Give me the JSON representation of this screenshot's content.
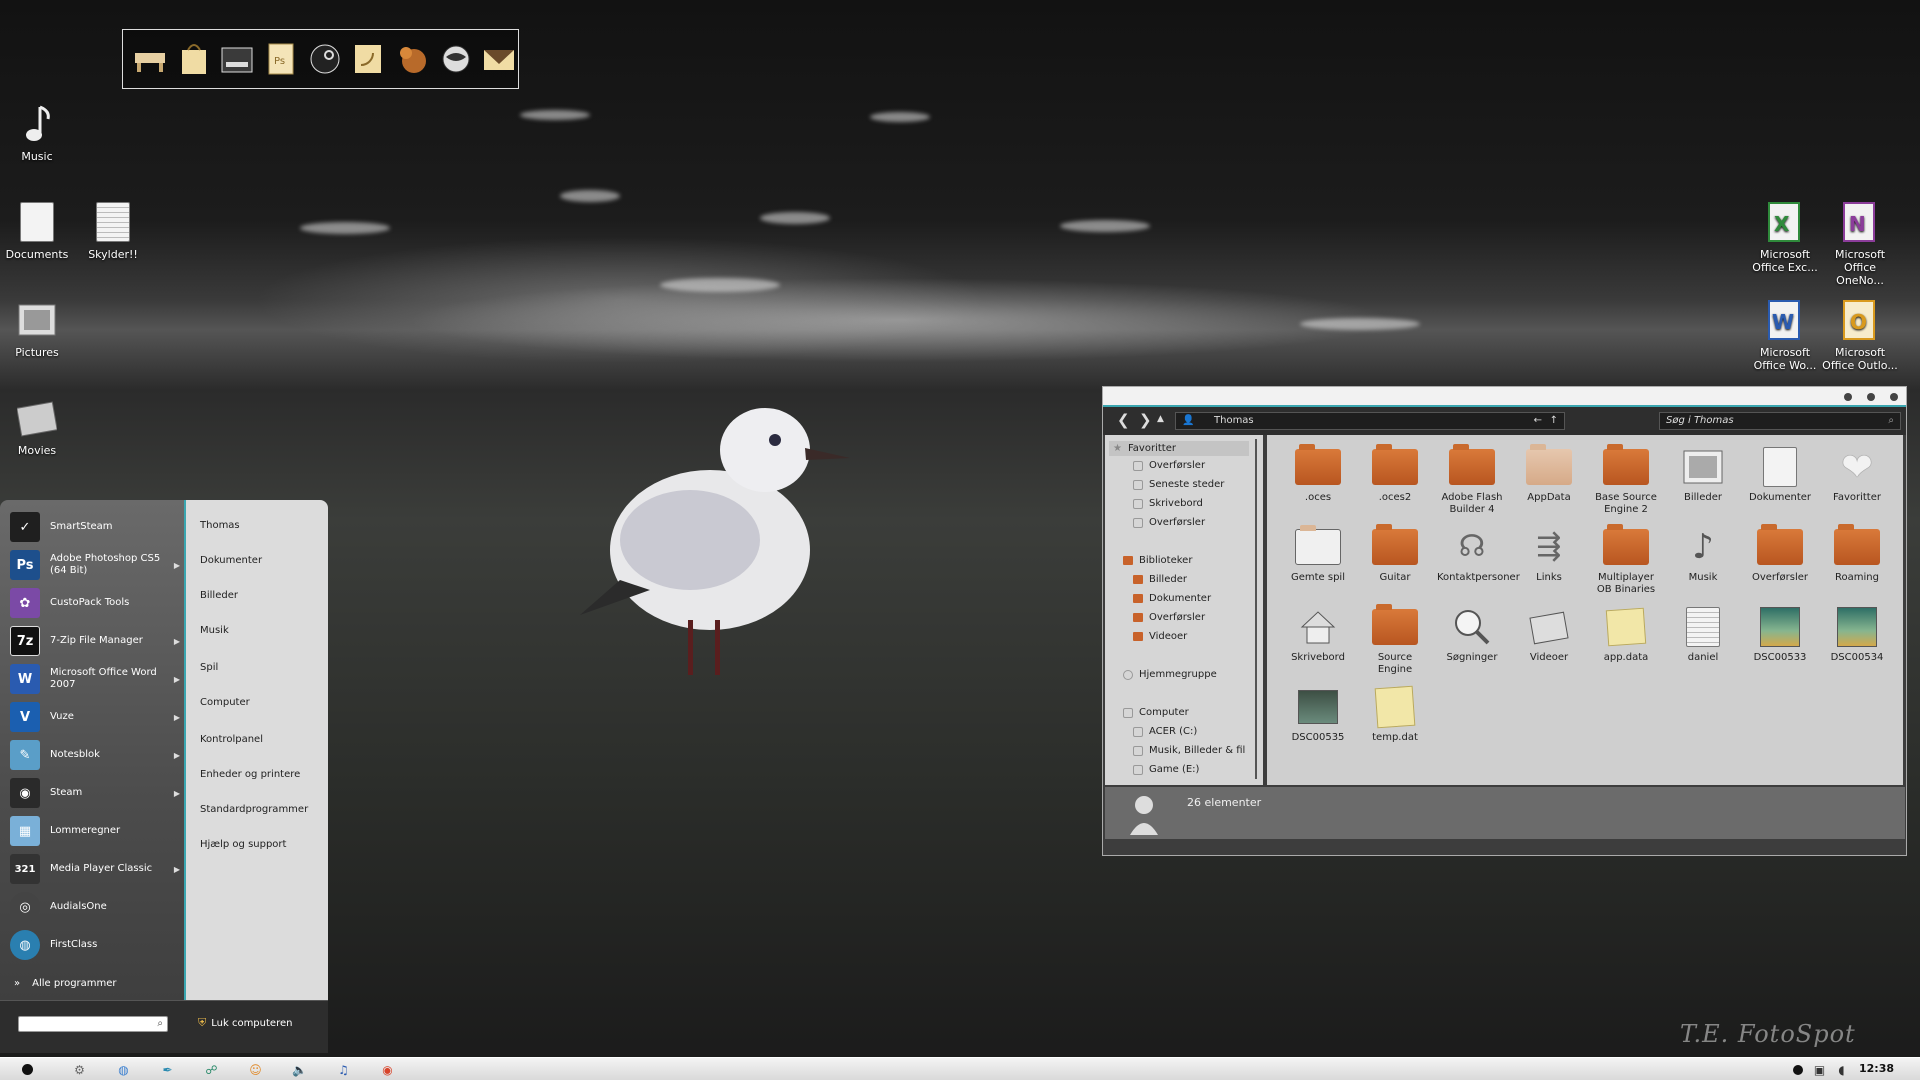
{
  "desktop": {
    "left_icons": [
      {
        "label": "Music",
        "icon": "music-note-icon"
      },
      {
        "label": "Documents",
        "icon": "document-icon"
      },
      {
        "label": "Skylder!!",
        "icon": "notepad-icon"
      },
      {
        "label": "Pictures",
        "icon": "picture-frame-icon"
      },
      {
        "label": "Movies",
        "icon": "film-strip-icon"
      }
    ],
    "right_icons": [
      {
        "label": "Microsoft Office Exc...",
        "icon": "excel-icon",
        "color": "#2f8a3b"
      },
      {
        "label": "Microsoft Office OneNo...",
        "icon": "onenote-icon",
        "color": "#8b3d9a"
      },
      {
        "label": "Microsoft Office Wo...",
        "icon": "word-icon",
        "color": "#2a5bb0"
      },
      {
        "label": "Microsoft Office Outlo...",
        "icon": "outlook-icon",
        "color": "#d99a1e"
      }
    ],
    "watermark": "T.E. FotoSpot"
  },
  "dock": {
    "items": [
      "desk-icon",
      "bag-icon",
      "drive-icon",
      "photoshop-doc-icon",
      "steam-icon",
      "rss-icon",
      "squirrel-icon",
      "globe-icon",
      "envelope-icon"
    ]
  },
  "start_menu": {
    "programs": [
      {
        "label": "SmartSteam",
        "icon": "smartsteam-icon",
        "color": "#1f1f1f",
        "glyph": "✓",
        "has_submenu": false
      },
      {
        "label": "Adobe Photoshop CS5 (64 Bit)",
        "icon": "photoshop-icon",
        "color": "#1d4f8c",
        "glyph": "Ps",
        "has_submenu": true
      },
      {
        "label": "CustoPack Tools",
        "icon": "custopack-icon",
        "color": "#7b4aa6",
        "glyph": "✿",
        "has_submenu": false
      },
      {
        "label": "7-Zip File Manager",
        "icon": "7zip-icon",
        "color": "#111111",
        "glyph": "7z",
        "has_submenu": true
      },
      {
        "label": "Microsoft Office Word 2007",
        "icon": "word-icon",
        "color": "#2a5bb0",
        "glyph": "W",
        "has_submenu": true
      },
      {
        "label": "Vuze",
        "icon": "vuze-icon",
        "color": "#1b5fb0",
        "glyph": "V",
        "has_submenu": true
      },
      {
        "label": "Notesblok",
        "icon": "notepad-icon",
        "color": "#5a9ec8",
        "glyph": "✎",
        "has_submenu": true
      },
      {
        "label": "Steam",
        "icon": "steam-icon",
        "color": "#2a2a2a",
        "glyph": "◉",
        "has_submenu": true
      },
      {
        "label": "Lommeregner",
        "icon": "calculator-icon",
        "color": "#7ab0d8",
        "glyph": "▦",
        "has_submenu": false
      },
      {
        "label": "Media Player Classic",
        "icon": "mpc-icon",
        "color": "#333333",
        "glyph": "321",
        "has_submenu": true
      },
      {
        "label": "AudialsOne",
        "icon": "audials-icon",
        "color": "#444444",
        "glyph": "◎",
        "has_submenu": false
      },
      {
        "label": "FirstClass",
        "icon": "firstclass-icon",
        "color": "#2a7fb0",
        "glyph": "◍",
        "has_submenu": false
      }
    ],
    "all_programs": "Alle programmer",
    "links": [
      "Thomas",
      "Dokumenter",
      "Billeder",
      "Musik",
      "Spil",
      "Computer",
      "Kontrolpanel",
      "Enheder og printere",
      "Standardprogrammer",
      "Hjælp og support"
    ],
    "shutdown_label": "Luk computeren",
    "search_value": ""
  },
  "explorer": {
    "address": "Thomas",
    "search_placeholder": "Søg i Thomas",
    "nav": [
      {
        "label": "Favoritter",
        "kind": "header"
      },
      {
        "label": "Overførsler",
        "kind": "dim"
      },
      {
        "label": "Seneste steder",
        "kind": "dim"
      },
      {
        "label": "Skrivebord",
        "kind": "dim"
      },
      {
        "label": "Overførsler",
        "kind": "dim"
      },
      {
        "label": "Biblioteker",
        "kind": "header-folder"
      },
      {
        "label": "Billeder",
        "kind": "folder"
      },
      {
        "label": "Dokumenter",
        "kind": "folder"
      },
      {
        "label": "Overførsler",
        "kind": "folder"
      },
      {
        "label": "Videoer",
        "kind": "folder"
      },
      {
        "label": "Hjemmegruppe",
        "kind": "header"
      },
      {
        "label": "Computer",
        "kind": "header"
      },
      {
        "label": "ACER (C:)",
        "kind": "dim"
      },
      {
        "label": "Musik, Billeder & fil",
        "kind": "dim"
      },
      {
        "label": "Game (E:)",
        "kind": "dim"
      }
    ],
    "files": [
      {
        "label": ".oces",
        "type": "folder"
      },
      {
        "label": ".oces2",
        "type": "folder"
      },
      {
        "label": "Adobe Flash Builder 4",
        "type": "folder"
      },
      {
        "label": "AppData",
        "type": "folder-light"
      },
      {
        "label": "Base Source Engine 2",
        "type": "folder"
      },
      {
        "label": "Billeder",
        "type": "picture"
      },
      {
        "label": "Dokumenter",
        "type": "doc"
      },
      {
        "label": "Favoritter",
        "type": "heart"
      },
      {
        "label": "Gemte spil",
        "type": "folder-open"
      },
      {
        "label": "Guitar",
        "type": "folder"
      },
      {
        "label": "Kontaktpersoner",
        "type": "contacts"
      },
      {
        "label": "Links",
        "type": "links"
      },
      {
        "label": "Multiplayer OB Binaries",
        "type": "folder"
      },
      {
        "label": "Musik",
        "type": "music"
      },
      {
        "label": "Overførsler",
        "type": "folder"
      },
      {
        "label": "Roaming",
        "type": "folder"
      },
      {
        "label": "Skrivebord",
        "type": "house"
      },
      {
        "label": "Source Engine",
        "type": "folder"
      },
      {
        "label": "Søgninger",
        "type": "search"
      },
      {
        "label": "Videoer",
        "type": "film"
      },
      {
        "label": "app.data",
        "type": "sticky"
      },
      {
        "label": "daniel",
        "type": "doc"
      },
      {
        "label": "DSC00533",
        "type": "photo"
      },
      {
        "label": "DSC00534",
        "type": "photo"
      },
      {
        "label": "DSC00535",
        "type": "photo2"
      },
      {
        "label": "temp.dat",
        "type": "sticky"
      }
    ],
    "status": "26 elementer"
  },
  "taskbar": {
    "icons": [
      "start-orb-icon",
      "gear-icon",
      "globe-icon",
      "feather-icon",
      "network-icon",
      "firefox-icon",
      "volume-icon",
      "music-icon",
      "chrome-icon"
    ],
    "clock": "12:38",
    "accent": "#3aa6b0"
  }
}
